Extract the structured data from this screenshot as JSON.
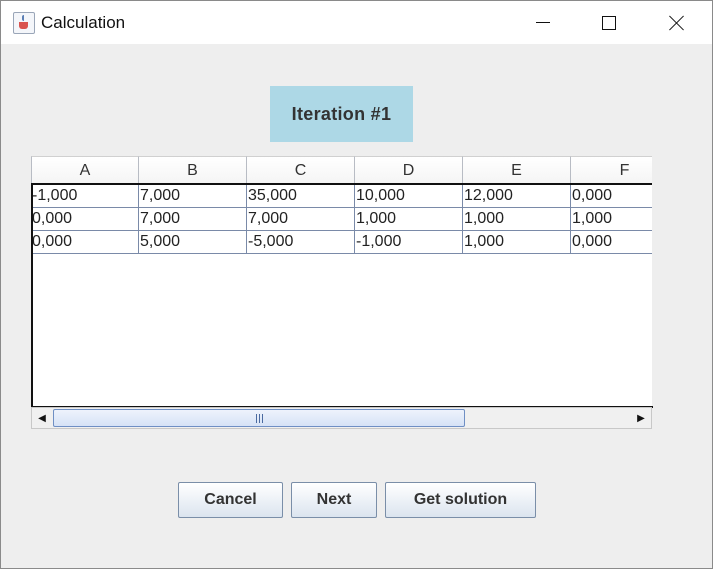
{
  "window": {
    "title": "Calculation",
    "icon": "java-coffee-cup-icon",
    "controls": [
      "minimize-icon",
      "maximize-icon",
      "close-icon"
    ]
  },
  "iteration_label": "Iteration #1",
  "table": {
    "columns": [
      "A",
      "B",
      "C",
      "D",
      "E",
      "F"
    ],
    "rows": [
      [
        "-1,000",
        "7,000",
        "35,000",
        "10,000",
        "12,000",
        "0,000"
      ],
      [
        "0,000",
        "7,000",
        "7,000",
        "1,000",
        "1,000",
        "1,000"
      ],
      [
        "0,000",
        "5,000",
        "-5,000",
        "-1,000",
        "1,000",
        "0,000"
      ]
    ]
  },
  "buttons": {
    "cancel": "Cancel",
    "next": "Next",
    "get_solution": "Get solution"
  },
  "colors": {
    "iteration_label_bg": "#add8e6",
    "window_bg": "#eeeeee",
    "grid_line": "#7a8aa8"
  }
}
